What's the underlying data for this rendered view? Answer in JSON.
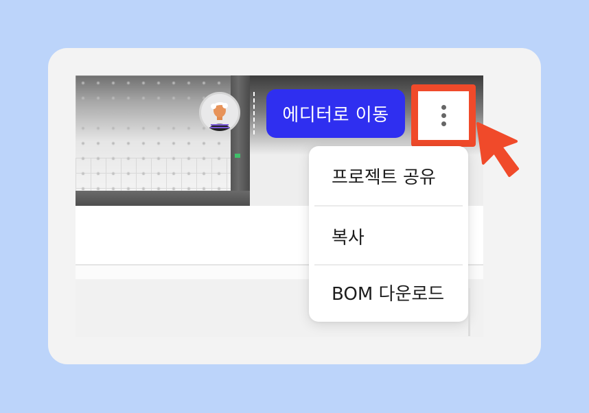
{
  "toolbar": {
    "editor_button_label": "에디터로 이동",
    "more_button_icon": "more-vertical-icon"
  },
  "avatar": {
    "icon": "user-avatar-icon"
  },
  "menu": {
    "items": [
      {
        "label": "프로젝트 공유"
      },
      {
        "label": "복사"
      },
      {
        "label": "BOM 다운로드"
      }
    ]
  },
  "annotation": {
    "highlight_color": "#f04a2a",
    "pointer_icon": "cursor-arrow-icon"
  },
  "colors": {
    "background": "#bcd4fa",
    "card": "#f3f3f3",
    "accent": "#2f2ff0"
  }
}
